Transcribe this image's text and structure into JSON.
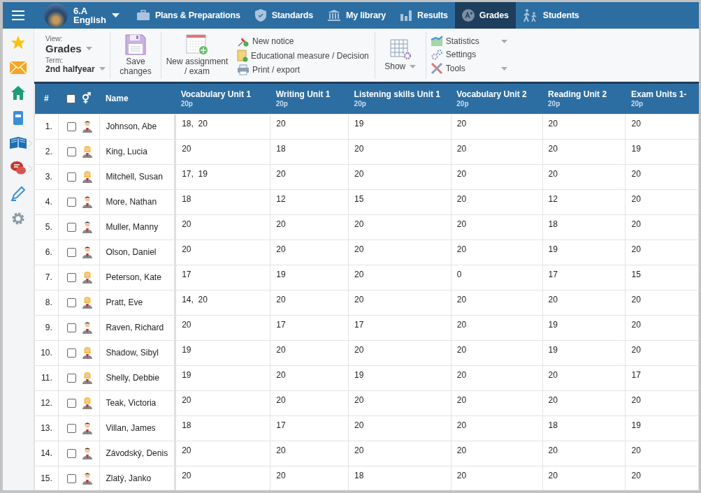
{
  "class_selector": {
    "class": "6.A",
    "subject": "English"
  },
  "nav_tabs": [
    {
      "label": "Plans & Preparations",
      "selected": false
    },
    {
      "label": "Standards",
      "selected": false
    },
    {
      "label": "My library",
      "selected": false
    },
    {
      "label": "Results",
      "selected": false
    },
    {
      "label": "Grades",
      "selected": true
    },
    {
      "label": "Students",
      "selected": false
    }
  ],
  "sidebar": [
    {
      "chevron": false
    },
    {
      "chevron": false
    },
    {
      "chevron": false
    },
    {
      "chevron": false
    },
    {
      "chevron": true
    },
    {
      "chevron": true
    },
    {
      "chevron": false
    },
    {
      "chevron": false
    }
  ],
  "toolbar": {
    "view_label": "View:",
    "view_value": "Grades",
    "term_label": "Term:",
    "term_value": "2nd halfyear",
    "save": "Save changes",
    "new_assignment": "New assignment / exam",
    "actions": [
      {
        "label": "New notice"
      },
      {
        "label": "Educational measure / Decision"
      },
      {
        "label": "Print / export"
      }
    ],
    "show": "Show",
    "tools": [
      {
        "label": "Statistics",
        "dropdown": true
      },
      {
        "label": "Settings",
        "dropdown": false
      },
      {
        "label": "Tools",
        "dropdown": true
      }
    ]
  },
  "table": {
    "index_header": "#",
    "name_header": "Name",
    "gender_header": "⚥",
    "select_all_checked": false,
    "columns": [
      {
        "title": "Vocabulary Unit 1",
        "points": "20p"
      },
      {
        "title": "Writing Unit 1",
        "points": "20p"
      },
      {
        "title": "Listening skills Unit 1",
        "points": "20p"
      },
      {
        "title": "Vocabulary Unit 2",
        "points": "20p"
      },
      {
        "title": "Reading Unit 2",
        "points": "20p"
      },
      {
        "title": "Exam Units 1-",
        "points": "20p"
      }
    ],
    "rows": [
      {
        "index": "1.",
        "name": "Johnson, Abe",
        "kind": "male",
        "checked": false,
        "grades": [
          "18,  20",
          "20",
          "19",
          "20",
          "20",
          "20"
        ]
      },
      {
        "index": "2.",
        "name": "King, Lucia",
        "kind": "female",
        "checked": false,
        "grades": [
          "20",
          "18",
          "20",
          "20",
          "20",
          "19"
        ]
      },
      {
        "index": "3.",
        "name": "Mitchell, Susan",
        "kind": "female",
        "checked": false,
        "grades": [
          "17,  19",
          "20",
          "20",
          "20",
          "20",
          "20"
        ]
      },
      {
        "index": "4.",
        "name": "More, Nathan",
        "kind": "male",
        "checked": false,
        "grades": [
          "18",
          "12",
          "15",
          "20",
          "12",
          "20"
        ]
      },
      {
        "index": "5.",
        "name": "Muller, Manny",
        "kind": "male",
        "checked": false,
        "grades": [
          "20",
          "20",
          "20",
          "20",
          "18",
          "20"
        ]
      },
      {
        "index": "6.",
        "name": "Olson, Daniel",
        "kind": "male",
        "checked": false,
        "grades": [
          "20",
          "20",
          "20",
          "20",
          "19",
          "20"
        ]
      },
      {
        "index": "7.",
        "name": "Peterson, Kate",
        "kind": "female",
        "checked": false,
        "grades": [
          "17",
          "19",
          "20",
          "0",
          "17",
          "15"
        ]
      },
      {
        "index": "8.",
        "name": "Pratt, Eve",
        "kind": "female",
        "checked": false,
        "grades": [
          "14,  20",
          "20",
          "20",
          "20",
          "20",
          "20"
        ]
      },
      {
        "index": "9.",
        "name": "Raven, Richard",
        "kind": "male",
        "checked": false,
        "grades": [
          "20",
          "17",
          "17",
          "20",
          "19",
          "20"
        ]
      },
      {
        "index": "10.",
        "name": "Shadow, Sibyl",
        "kind": "female",
        "checked": false,
        "grades": [
          "19",
          "20",
          "20",
          "20",
          "19",
          "20"
        ]
      },
      {
        "index": "11.",
        "name": "Shelly, Debbie",
        "kind": "female",
        "checked": false,
        "grades": [
          "19",
          "20",
          "19",
          "20",
          "20",
          "17"
        ]
      },
      {
        "index": "12.",
        "name": "Teak, Victoria",
        "kind": "female",
        "checked": false,
        "grades": [
          "20",
          "20",
          "20",
          "20",
          "20",
          "20"
        ]
      },
      {
        "index": "13.",
        "name": "Villan, James",
        "kind": "male",
        "checked": false,
        "grades": [
          "18",
          "17",
          "20",
          "20",
          "18",
          "19"
        ]
      },
      {
        "index": "14.",
        "name": "Závodský, Denis",
        "kind": "male",
        "checked": false,
        "grades": [
          "20",
          "20",
          "20",
          "20",
          "20",
          "20"
        ]
      },
      {
        "index": "15.",
        "name": "Zlatý, Janko",
        "kind": "male",
        "checked": false,
        "grades": [
          "20",
          "20",
          "18",
          "20",
          "20",
          "20"
        ]
      }
    ]
  }
}
